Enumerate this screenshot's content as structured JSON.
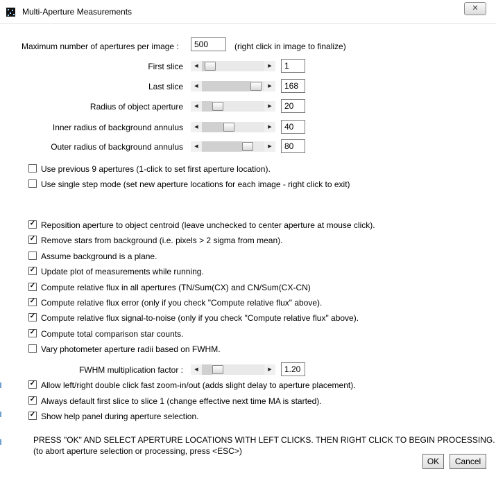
{
  "window": {
    "title": "Multi-Aperture Measurements",
    "close_glyph": "✕"
  },
  "max_apertures": {
    "label": "Maximum number of apertures per image :",
    "value": "500",
    "hint": "(right click in image to finalize)"
  },
  "sliders": [
    {
      "label": "First slice",
      "value": "1",
      "level": 0.06
    },
    {
      "label": "Last slice",
      "value": "168",
      "level": 0.94
    },
    {
      "label": "Radius of object aperture",
      "value": "20",
      "level": 0.2
    },
    {
      "label": "Inner radius of background annulus",
      "value": "40",
      "level": 0.42
    },
    {
      "label": "Outer radius of background annulus",
      "value": "80",
      "level": 0.78
    }
  ],
  "checkboxes_top": [
    {
      "label": "Use previous 9 apertures (1-click to set first aperture location).",
      "checked": false
    },
    {
      "label": "Use single step mode (set new aperture locations for each image - right click to exit)",
      "checked": false
    }
  ],
  "checkboxes_main": [
    {
      "label": "Reposition aperture to object centroid (leave unchecked to center aperture at mouse click).",
      "checked": true
    },
    {
      "label": "Remove stars from background (i.e. pixels > 2 sigma from mean).",
      "checked": true
    },
    {
      "label": "Assume background is a plane.",
      "checked": false
    },
    {
      "label": "Update plot of measurements while running.",
      "checked": true
    },
    {
      "label": "Compute relative flux in all apertures (TN/Sum(CX) and CN/Sum(CX-CN)",
      "checked": true
    },
    {
      "label": "Compute relative flux error (only if you check \"Compute relative flux\" above).",
      "checked": true
    },
    {
      "label": "Compute relative flux signal-to-noise (only if you check \"Compute relative flux\" above).",
      "checked": true
    },
    {
      "label": "Compute total comparison star counts.",
      "checked": true
    },
    {
      "label": "Vary photometer aperture radii based on FWHM.",
      "checked": false
    }
  ],
  "fwhm": {
    "label": "FWHM multiplication factor :",
    "value": "1.20",
    "level": 0.2
  },
  "checkboxes_bottom": [
    {
      "label": "Allow left/right double click fast zoom-in/out (adds slight delay to aperture placement).",
      "checked": true
    },
    {
      "label": "Always default first slice to slice 1 (change effective next time MA is started).",
      "checked": true
    },
    {
      "label": "Show help panel during aperture selection.",
      "checked": true
    }
  ],
  "message": {
    "line1": "PRESS \"OK\" AND SELECT APERTURE LOCATIONS WITH LEFT CLICKS. THEN RIGHT CLICK TO BEGIN PROCESSING.",
    "line2": "(to abort aperture selection or processing, press <ESC>)"
  },
  "buttons": {
    "ok": "OK",
    "cancel": "Cancel"
  },
  "glyphs": {
    "left_arrow": "◀",
    "right_arrow": "▶",
    "check": "✓"
  }
}
